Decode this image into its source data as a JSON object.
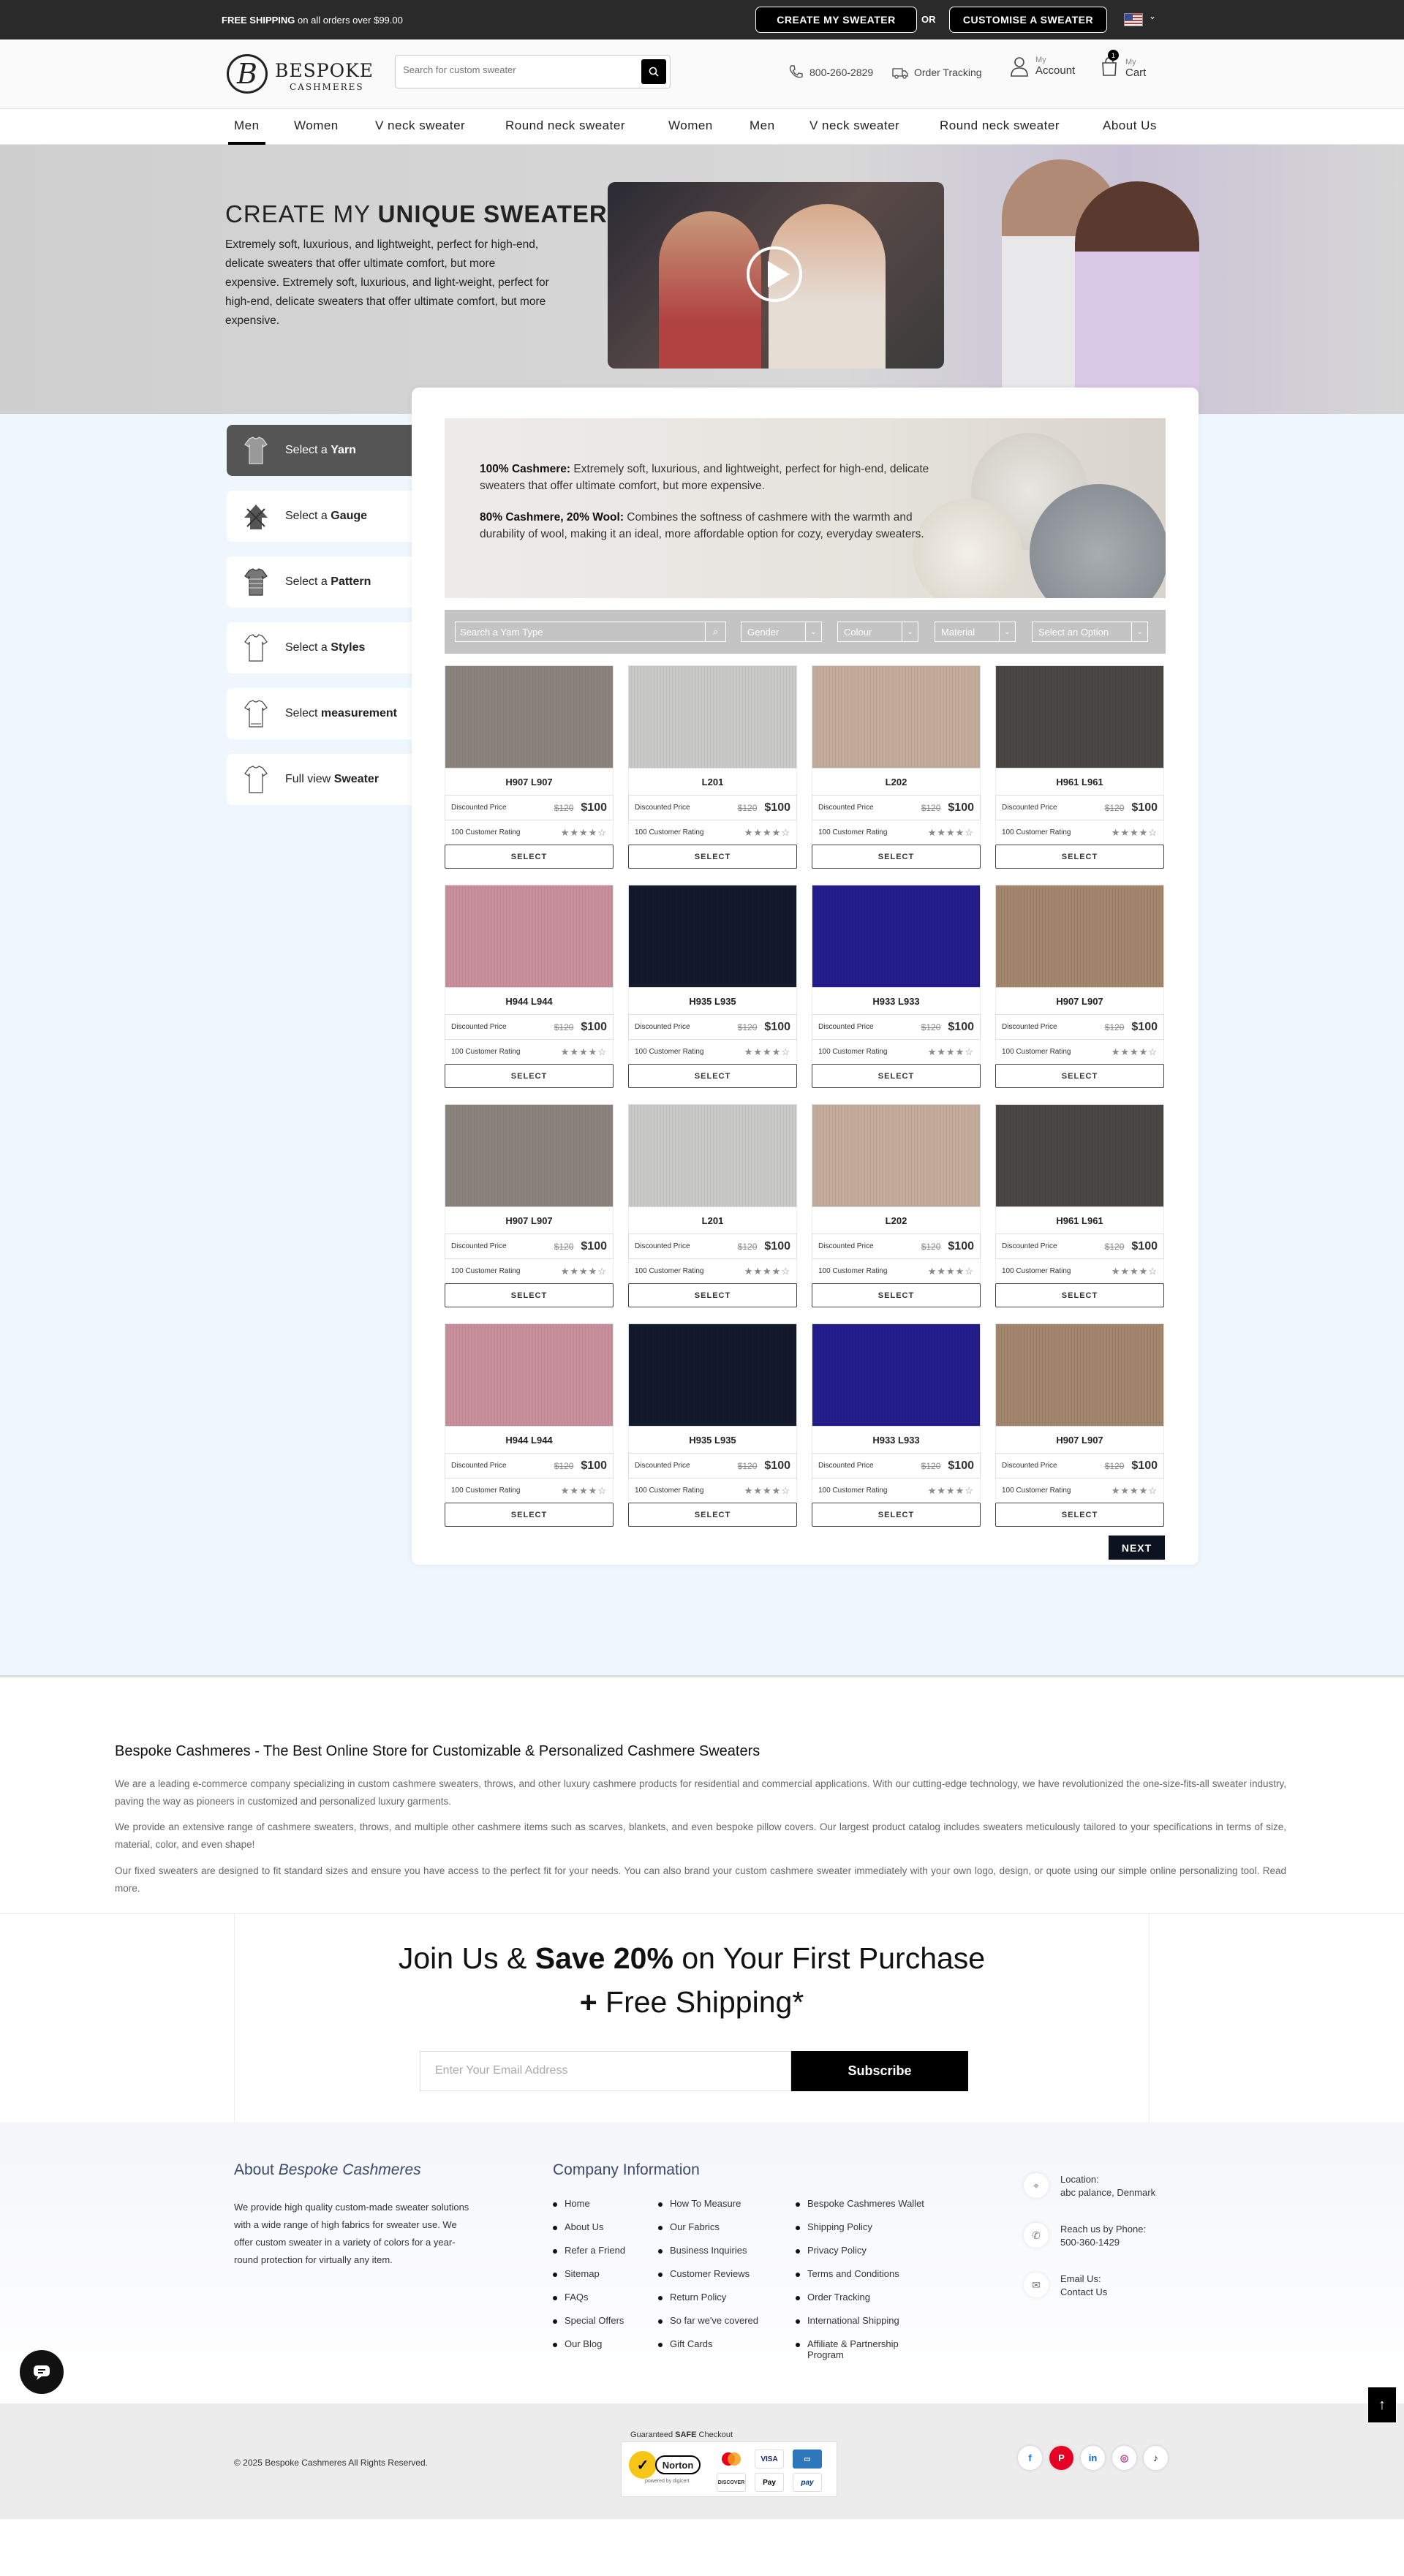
{
  "topbar": {
    "shipping_bold": "FREE SHIPPING",
    "shipping_rest": " on all orders over $99.00",
    "create_btn": "CREATE MY SWEATER",
    "or": "OR",
    "customise_btn": "CUSTOMISE A SWEATER"
  },
  "header": {
    "logo_mark": "B",
    "logo_line1": "BESPOKE",
    "logo_line2": "CASHMERES",
    "search_placeholder": "Search for custom sweater",
    "phone": "800-260-2829",
    "order_tracking": "Order Tracking",
    "account_small": "My",
    "account_big": "Account",
    "cart_small": "My",
    "cart_big": "Cart",
    "cart_count": "1"
  },
  "nav": [
    "Men",
    "Women",
    "V neck sweater",
    "Round neck sweater",
    "Women",
    "Men",
    "V neck sweater",
    "Round neck sweater",
    "About Us"
  ],
  "hero": {
    "title_prefix": "CREATE MY ",
    "title_bold": "UNIQUE SWEATER",
    "text": "Extremely soft, luxurious, and lightweight, perfect for high-end, delicate sweaters that offer ultimate comfort, but more expensive. Extremely soft, luxurious, and light-weight, perfect for high-end, delicate sweaters that offer ultimate comfort, but more expensive."
  },
  "steps": [
    {
      "pre": "Select a ",
      "bold": "Yarn"
    },
    {
      "pre": "Select a ",
      "bold": "Gauge"
    },
    {
      "pre": "Select a ",
      "bold": "Pattern"
    },
    {
      "pre": "Select a ",
      "bold": "Styles"
    },
    {
      "pre": "Select ",
      "bold": "measurement"
    },
    {
      "pre": "Full view ",
      "bold": "Sweater"
    }
  ],
  "banner": {
    "b1": "100% Cashmere:",
    "t1": " Extremely soft, luxurious, and lightweight, perfect for high-end, delicate sweaters that offer ultimate comfort, but more expensive.",
    "b2": "80% Cashmere, 20% Wool:",
    "t2": " Combines the softness of cashmere with the warmth and durability of wool, making it an ideal, more affordable option for cozy, everyday sweaters."
  },
  "filters": {
    "search_placeholder": "Search a  Yarn Type",
    "gender": "Gender",
    "colour": "Colour",
    "material": "Material",
    "option": "Select an Option"
  },
  "card_labels": {
    "discounted": "Discounted Price",
    "old_price": "$120",
    "new_price": "$100",
    "rating": "100 Customer Rating",
    "stars": "★★★★☆",
    "select": "SELECT"
  },
  "products": [
    {
      "name": "H907 L907",
      "color": "#8a847c"
    },
    {
      "name": "L201",
      "color": "#c9c9c7"
    },
    {
      "name": "L202",
      "color": "#c2ab9b"
    },
    {
      "name": "H961 L961",
      "color": "#4a4644"
    },
    {
      "name": "H944 L944",
      "color": "#c98e9c"
    },
    {
      "name": "H935 L935",
      "color": "#141a2b"
    },
    {
      "name": "H933 L933",
      "color": "#231c8c"
    },
    {
      "name": "H907 L907",
      "color": "#a3866e"
    },
    {
      "name": "H907 L907",
      "color": "#8a847c"
    },
    {
      "name": "L201",
      "color": "#c9c9c7"
    },
    {
      "name": "L202",
      "color": "#c2ab9b"
    },
    {
      "name": "H961 L961",
      "color": "#4a4644"
    },
    {
      "name": "H944 L944",
      "color": "#c98e9c"
    },
    {
      "name": "H935 L935",
      "color": "#141a2b"
    },
    {
      "name": "H933 L933",
      "color": "#231c8c"
    },
    {
      "name": "H907 L907",
      "color": "#a3866e"
    }
  ],
  "next": "NEXT",
  "about": {
    "title": "Bespoke Cashmeres - The Best Online Store for Customizable & Personalized Cashmere Sweaters",
    "p1": "We are a leading e-commerce company specializing in custom cashmere sweaters, throws, and other luxury cashmere products for residential and commercial applications. With our cutting-edge technology, we have revolutionized the one-size-fits-all sweater industry, paving the way as pioneers in customized and personalized luxury garments.",
    "p2": "We provide an extensive range of cashmere sweaters, throws, and multiple other cashmere items such as scarves, blankets, and even bespoke pillow covers. Our largest product catalog includes sweaters meticulously tailored to your specifications in terms of size, material, color, and even shape!",
    "p3": "Our fixed sweaters are designed to fit standard sizes and ensure you have access to the perfect fit for your needs. You can also brand your custom cashmere sweater immediately with your own logo, design, or quote using our simple online personalizing tool. Read more."
  },
  "join": {
    "l1_pre": "Join Us & ",
    "l1_bold": "Save 20%",
    "l1_post": " on Your First Purchase",
    "l2_bold": "+",
    "l2_rest": " Free Shipping*",
    "email_placeholder": "Enter Your Email Address",
    "subscribe": "Subscribe"
  },
  "footer": {
    "about_title_pre": "About ",
    "about_title_it": "Bespoke Cashmeres",
    "about_text": "We provide high quality custom-made sweater solutions with a wide range of high fabrics for sweater use. We offer custom sweater in a variety of colors for a year-round protection for virtually any item.",
    "company_title": "Company Information",
    "col1": [
      "Home",
      "About Us",
      "Refer a Friend",
      "Sitemap",
      "FAQs",
      "Special Offers",
      "Our Blog"
    ],
    "col2": [
      "How To Measure",
      "Our Fabrics",
      "Business Inquiries",
      "Customer Reviews",
      "Return Policy",
      "So far we've covered",
      "Gift Cards"
    ],
    "col3": [
      "Bespoke Cashmeres Wallet",
      "Shipping Policy",
      "Privacy Policy",
      "Terms and Conditions",
      "Order Tracking",
      "International Shipping",
      "Affiliate & Partnership Program"
    ],
    "location_label": "Location:",
    "location": "abc palance, Denmark",
    "phone_label": "Reach us by Phone:",
    "phone": "500-360-1429",
    "email_label": "Email Us:",
    "email": "Contact Us"
  },
  "bottom": {
    "copyright": "© 2025 Bespoke Cashmeres All Rights Reserved.",
    "guaranteed_pre": "Guaranteed ",
    "guaranteed_bold": "SAFE",
    "guaranteed_post": " Checkout",
    "norton": "Norton",
    "norton_sub": "powered by digicert",
    "visa": "VISA",
    "discover": "DISCOVER",
    "applepay": "Pay",
    "paypal": "pay"
  },
  "social": [
    "f",
    "P",
    "in",
    "◎",
    "♪"
  ]
}
